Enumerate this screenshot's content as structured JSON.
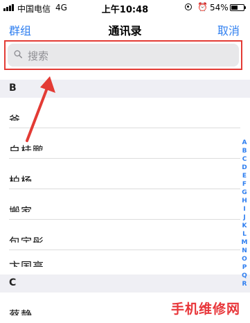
{
  "status_bar": {
    "carrier": "中国电信",
    "network": "4G",
    "time": "上午10:48",
    "battery_percent": "54%",
    "battery_level": 0.54,
    "icons": [
      "signal-bars-icon",
      "orientation-lock-icon",
      "alarm-icon",
      "battery-icon"
    ]
  },
  "nav": {
    "left_label": "群组",
    "title": "通讯录",
    "right_label": "取消"
  },
  "search": {
    "placeholder": "搜索",
    "icon": "search-icon",
    "highlight_color": "#e33b35"
  },
  "sections": [
    {
      "letter": "B",
      "contacts": [
        "爸",
        "白桂鹏",
        "柏杨",
        "搬家",
        "包宇彤",
        "卞国亮"
      ]
    },
    {
      "letter": "C",
      "contacts": [
        "蔡静"
      ]
    }
  ],
  "index_letters": [
    "A",
    "B",
    "C",
    "D",
    "E",
    "F",
    "G",
    "H",
    "I",
    "J",
    "K",
    "L",
    "M",
    "N",
    "O",
    "P",
    "Q",
    "R"
  ],
  "watermark": "手机维修网",
  "colors": {
    "accent": "#2f7ff0",
    "annotation_red": "#e33b35",
    "section_bg": "#efeff4"
  }
}
